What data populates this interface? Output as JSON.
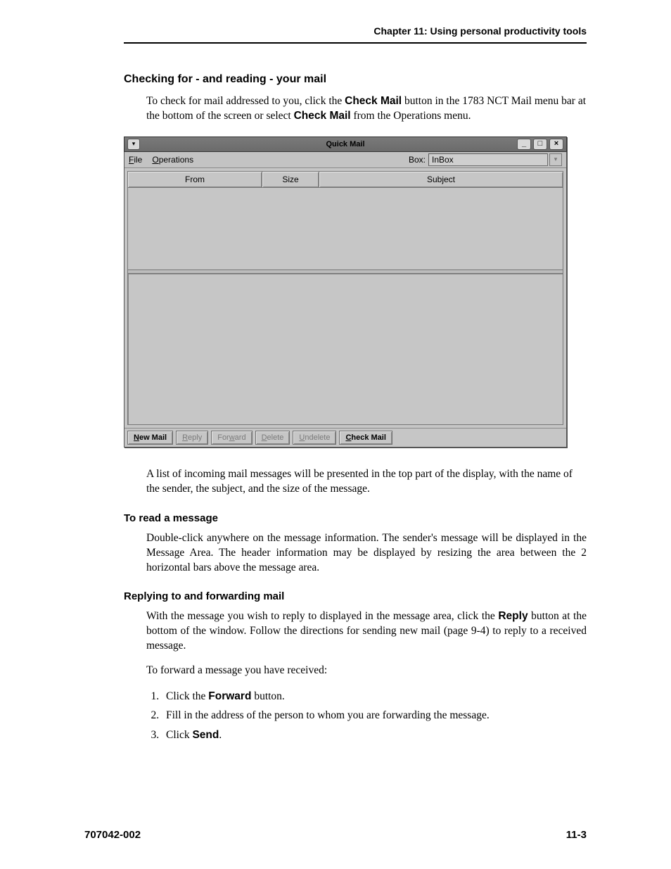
{
  "header": {
    "chapter": "Chapter 11: Using personal productivity tools"
  },
  "section1": {
    "heading": "Checking for - and reading - your mail",
    "p1a": "To check for mail addressed to you, click the ",
    "p1b": "Check Mail",
    "p1c": " button in the 1783 NCT Mail menu bar at the bottom of the screen or select ",
    "p1d": "Check Mail",
    "p1e": " from the Operations menu.",
    "p2": "A list of incoming mail messages will be presented in the top part of the display, with the name of the sender, the subject, and the size of the message."
  },
  "section2": {
    "heading": "To read a message",
    "p1": "Double-click anywhere on the message information. The sender's message will be displayed in the Message Area. The header information may be displayed by resizing the area between the 2 horizontal bars above the message area."
  },
  "section3": {
    "heading": "Replying to and forwarding mail",
    "p1a": "With the message you wish to reply to displayed in the message area, click the ",
    "p1b": "Reply",
    "p1c": " button at the bottom of the window. Follow the directions for sending new mail (page 9-4) to reply to a received message.",
    "p2": "To forward a message you have received:",
    "li1a": "Click the ",
    "li1b": "Forward",
    "li1c": " button.",
    "li2": "Fill in the address of the person to whom you are forwarding the message.",
    "li3a": "Click ",
    "li3b": "Send",
    "li3c": "."
  },
  "footer": {
    "left": "707042-002",
    "right": "11-3"
  },
  "qm": {
    "title": "Quick Mail",
    "menu": {
      "file_u": "F",
      "file_r": "ile",
      "ops_u": "O",
      "ops_r": "perations",
      "box_u": "B",
      "box_r": "ox:",
      "box_value": "InBox"
    },
    "cols": {
      "from": "From",
      "size": "Size",
      "subject": "Subject"
    },
    "buttons": {
      "newmail_u": "N",
      "newmail_r": "ew Mail",
      "reply_u": "R",
      "reply_r": "eply",
      "forward_a": "For",
      "forward_u": "w",
      "forward_b": "ard",
      "delete_u": "D",
      "delete_r": "elete",
      "undelete_u": "U",
      "undelete_r": "ndelete",
      "check_u": "C",
      "check_r": "heck Mail"
    },
    "winbtn": {
      "min": "_",
      "max": "□",
      "close": "×"
    }
  }
}
